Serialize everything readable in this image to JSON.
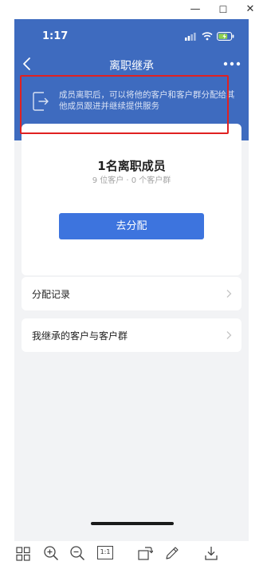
{
  "window": {
    "controls": [
      {
        "name": "minimize",
        "glyph": "—"
      },
      {
        "name": "maximize",
        "glyph": "☐"
      },
      {
        "name": "close",
        "glyph": "✕"
      }
    ]
  },
  "status_bar": {
    "time": "1:17",
    "icons": [
      "signal-icon",
      "wifi-icon",
      "battery-charging-icon"
    ]
  },
  "nav": {
    "title": "离职继承",
    "back_icon": "chevron-left-icon",
    "more_icon": "more-dots-icon"
  },
  "notice": {
    "icon": "transfer-doc-icon",
    "text": "成员离职后，可以将他的客户和客户群分配给其他成员跟进并继续提供服务"
  },
  "summary": {
    "title": "1名离职成员",
    "subtitle": "9 位客户 · 0 个客户群",
    "button": "去分配"
  },
  "rows": [
    {
      "label": "分配记录"
    },
    {
      "label": "我继承的客户与客户群"
    }
  ],
  "toolbar": {
    "tools": [
      "grid-icon",
      "zoom-in-icon",
      "zoom-out-icon",
      "actual-size-icon",
      "rotate-icon",
      "edit-icon",
      "download-icon"
    ],
    "actual_size_label": "1:1"
  },
  "colors": {
    "header": "#3e6bbf",
    "primary_button": "#3d74de",
    "highlight_box": "#e02121",
    "page_bg": "#f2f3f5"
  }
}
